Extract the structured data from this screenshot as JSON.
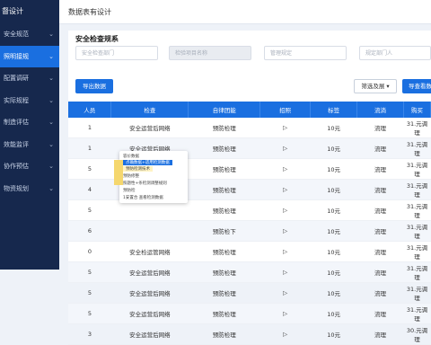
{
  "sidebar": {
    "title": "督设计",
    "items": [
      {
        "label": "安全规范",
        "active": false
      },
      {
        "label": "照明接规",
        "active": true
      },
      {
        "label": "配置调研",
        "active": false
      },
      {
        "label": "实际规程",
        "active": false
      },
      {
        "label": "制造评估",
        "active": false
      },
      {
        "label": "效能监评",
        "active": false
      },
      {
        "label": "协作预估",
        "active": false
      },
      {
        "label": "物资规划",
        "active": false
      }
    ]
  },
  "topbar": {
    "title": "数据表有设计"
  },
  "panel": {
    "title": "安全检查规系"
  },
  "filters": {
    "f1": "安全检查部门",
    "f2": "检验项目名称",
    "f3": "管理规定",
    "f4": "规定部门人"
  },
  "toolbar": {
    "export_label": "导出数据",
    "filter_label": "筛选及展 ▾",
    "query_label": "导查看数"
  },
  "table": {
    "headers": [
      "人员",
      "检查",
      "自律团能",
      "招照",
      "标签",
      "流淌",
      "购买"
    ],
    "rows": [
      [
        "1",
        "安全运营后网络",
        "预防检理",
        "▷",
        "10元",
        "流理",
        "31.元调理"
      ],
      [
        "1",
        "安全运营后网络",
        "预防检理",
        "▷",
        "10元",
        "流理",
        "31.元调理"
      ],
      [
        "5",
        "",
        "预防检理",
        "▷",
        "10元",
        "流理",
        "31.元调理"
      ],
      [
        "4",
        "",
        "预防检理",
        "▷",
        "10元",
        "流理",
        "31.元调理"
      ],
      [
        "5",
        "",
        "预防检理",
        "▷",
        "10元",
        "流理",
        "31.元调理"
      ],
      [
        "6",
        "",
        "预防检下",
        "▷",
        "10元",
        "流理",
        "31.元调理"
      ],
      [
        "0",
        "安全检运管网络",
        "预防检理",
        "▷",
        "10元",
        "流理",
        "31.元调理"
      ],
      [
        "5",
        "安全运营后网络",
        "预防检理",
        "▷",
        "10元",
        "流理",
        "31.元调理"
      ],
      [
        "5",
        "安全运营后网络",
        "预防检理",
        "▷",
        "10元",
        "流理",
        "31.元调理"
      ],
      [
        "5",
        "安全运营后网络",
        "预防检理",
        "▷",
        "10元",
        "流理",
        "31.元调理"
      ],
      [
        "3",
        "安全运营后网络",
        "预防检理",
        "▷",
        "10元",
        "流理",
        "30.元调理"
      ]
    ]
  },
  "popup": {
    "line1": "容价数据",
    "line2": "点确数据+适用检测数据",
    "line3": "预防检测技术",
    "line4": "预防修整",
    "line5": "照题性+条检测调整规则",
    "line6": "预防检",
    "line7": "1安置合 查看检测数据"
  }
}
